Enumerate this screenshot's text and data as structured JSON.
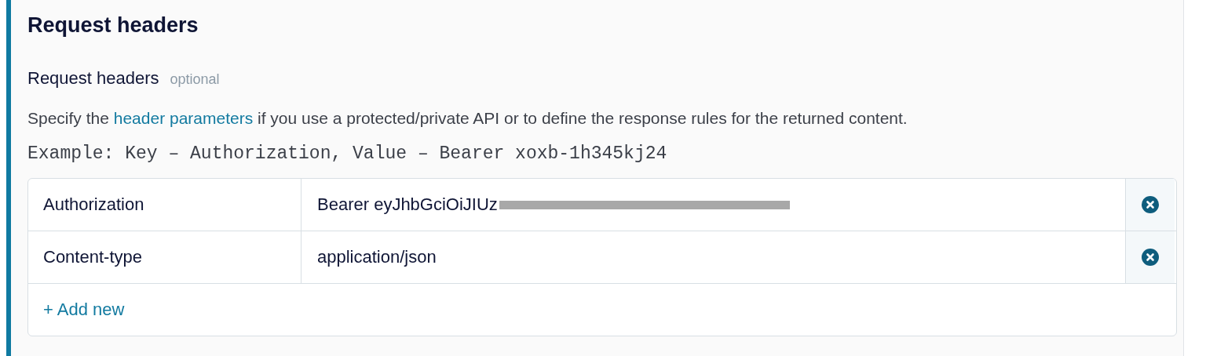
{
  "section_title": "Request headers",
  "field": {
    "label": "Request headers",
    "optional": "optional",
    "description": {
      "before": "Specify the ",
      "link": "header parameters",
      "after": " if you use a protected/private API or to define the response rules for the returned content."
    },
    "example": "Example: Key – Authorization, Value – Bearer xoxb-1h345kj24"
  },
  "headers": [
    {
      "key": "Authorization",
      "value": "Bearer eyJhbGciOiJIUz",
      "redacted": true
    },
    {
      "key": "Content-type",
      "value": "application/json",
      "redacted": false
    }
  ],
  "add_button": "+ Add new"
}
